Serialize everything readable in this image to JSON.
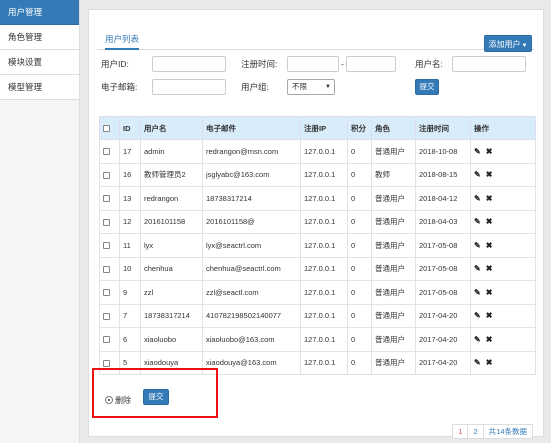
{
  "sidebar": {
    "items": [
      {
        "label": "用户管理",
        "active": true
      },
      {
        "label": "角色管理"
      },
      {
        "label": "模块设置"
      },
      {
        "label": "模型管理"
      }
    ]
  },
  "panel": {
    "tab_label": "用户列表",
    "add_button": "添加用户"
  },
  "filters": {
    "user_id_label": "用户ID:",
    "user_id_value": "",
    "reg_time_label": "注册时间:",
    "reg_time_from": "",
    "reg_time_sep": "-",
    "reg_time_to": "",
    "username_label": "用户名:",
    "username_value": "",
    "email_label": "电子邮箱:",
    "email_value": "",
    "group_label": "用户组:",
    "group_selected": "不限",
    "submit": "提交"
  },
  "table": {
    "headers": [
      "ID",
      "用户名",
      "电子邮件",
      "注册IP",
      "积分",
      "角色",
      "注册时间",
      "操作"
    ],
    "rows": [
      {
        "id": "17",
        "username": "admin",
        "email": "redrangon@msn.com",
        "ip": "127.0.0.1",
        "points": "0",
        "role": "普通用户",
        "date": "2018-10-08"
      },
      {
        "id": "16",
        "username": "教师管理员2",
        "email": "jsglyabc@163.com",
        "ip": "127.0.0.1",
        "points": "0",
        "role": "教师",
        "date": "2018-08-15"
      },
      {
        "id": "13",
        "username": "redrangon",
        "email": "18738317214",
        "ip": "127.0.0.1",
        "points": "0",
        "role": "普通用户",
        "date": "2018-04-12"
      },
      {
        "id": "12",
        "username": "2016101158",
        "email": "2016101158@",
        "ip": "127.0.0.1",
        "points": "0",
        "role": "普通用户",
        "date": "2018-04-03"
      },
      {
        "id": "11",
        "username": "lyx",
        "email": "lyx@seactrl.com",
        "ip": "127.0.0.1",
        "points": "0",
        "role": "普通用户",
        "date": "2017-05-08"
      },
      {
        "id": "10",
        "username": "chenhua",
        "email": "chenhua@seactrl.com",
        "ip": "127.0.0.1",
        "points": "0",
        "role": "普通用户",
        "date": "2017-05-08"
      },
      {
        "id": "9",
        "username": "zzl",
        "email": "zzl@seactl.com",
        "ip": "127.0.0.1",
        "points": "0",
        "role": "普通用户",
        "date": "2017-05-08"
      },
      {
        "id": "7",
        "username": "18738317214",
        "email": "410782198502140077",
        "ip": "127.0.0.1",
        "points": "0",
        "role": "普通用户",
        "date": "2017-04-20"
      },
      {
        "id": "6",
        "username": "xiaoluobo",
        "email": "xiaoluobo@163.com",
        "ip": "127.0.0.1",
        "points": "0",
        "role": "普通用户",
        "date": "2017-04-20"
      },
      {
        "id": "5",
        "username": "xiaodouya",
        "email": "xiaodouya@163.com",
        "ip": "127.0.0.1",
        "points": "0",
        "role": "普通用户",
        "date": "2017-04-20"
      }
    ]
  },
  "bulk": {
    "delete_label": "删除",
    "submit": "提交"
  },
  "pagination": {
    "pages": [
      "1",
      "2"
    ],
    "current": "1",
    "total": "共14条数据"
  },
  "icons": {
    "edit": "edit-icon",
    "delete": "delete-icon"
  },
  "colors": {
    "primary": "#337ab7",
    "table_header": "#d9ecfa",
    "highlight": "#ee1111"
  }
}
